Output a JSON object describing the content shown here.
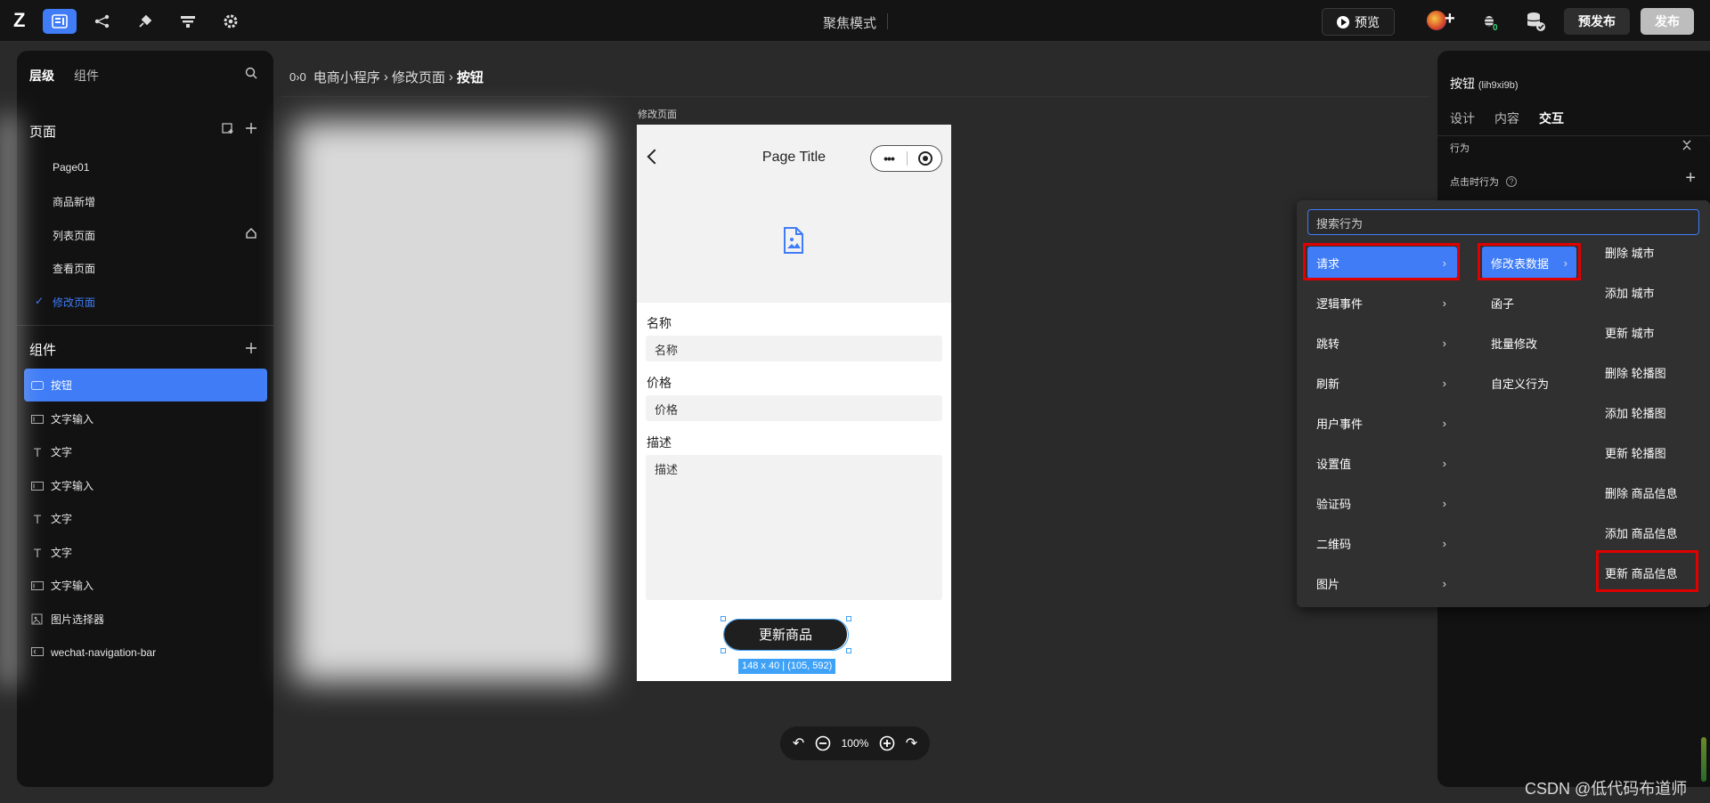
{
  "topbar": {
    "logo": "Z",
    "focus_mode": "聚焦模式",
    "preview": "预览",
    "prepublish": "预发布",
    "publish": "发布"
  },
  "left_panel": {
    "tabs": [
      "层级",
      "组件"
    ],
    "pages_title": "页面",
    "pages": [
      "Page01",
      "商品新增",
      "列表页面",
      "查看页面",
      "修改页面"
    ],
    "components_title": "组件",
    "components": [
      "按钮",
      "文字输入",
      "文字",
      "文字输入",
      "文字",
      "文字",
      "文字输入",
      "图片选择器",
      "wechat-navigation-bar"
    ]
  },
  "breadcrumb": {
    "items": [
      "电商小程序",
      "修改页面",
      "按钮"
    ]
  },
  "canvas": {
    "page_label": "修改页面",
    "nav_title": "Page Title",
    "capsule_dots": "•••",
    "field1_label": "名称",
    "field1_placeholder": "名称",
    "field2_label": "价格",
    "field2_placeholder": "价格",
    "field3_label": "描述",
    "field3_placeholder": "描述",
    "button_label": "更新商品",
    "size_tag": "148 x 40 | (105, 592)"
  },
  "zoom": {
    "level": "100%"
  },
  "right_panel": {
    "title": "按钮",
    "title_id": "(lih9xi9b)",
    "tabs": [
      "设计",
      "内容",
      "交互"
    ],
    "behavior_label": "行为",
    "click_label": "点击时行为"
  },
  "dropdown": {
    "search_placeholder": "搜索行为",
    "col1": [
      "请求",
      "逻辑事件",
      "跳转",
      "刷新",
      "用户事件",
      "设置值",
      "验证码",
      "二维码",
      "图片"
    ],
    "col2": [
      "修改表数据",
      "函子",
      "批量修改",
      "自定义行为"
    ],
    "col3": [
      "删除 城市",
      "添加 城市",
      "更新 城市",
      "删除 轮播图",
      "添加 轮播图",
      "更新 轮播图",
      "删除 商品信息",
      "添加 商品信息",
      "更新 商品信息"
    ]
  },
  "watermark": "CSDN @低代码布道师",
  "colors": {
    "accent": "#3f7cf6",
    "highlight_border": "#e00000",
    "panel_bg": "#121212"
  }
}
